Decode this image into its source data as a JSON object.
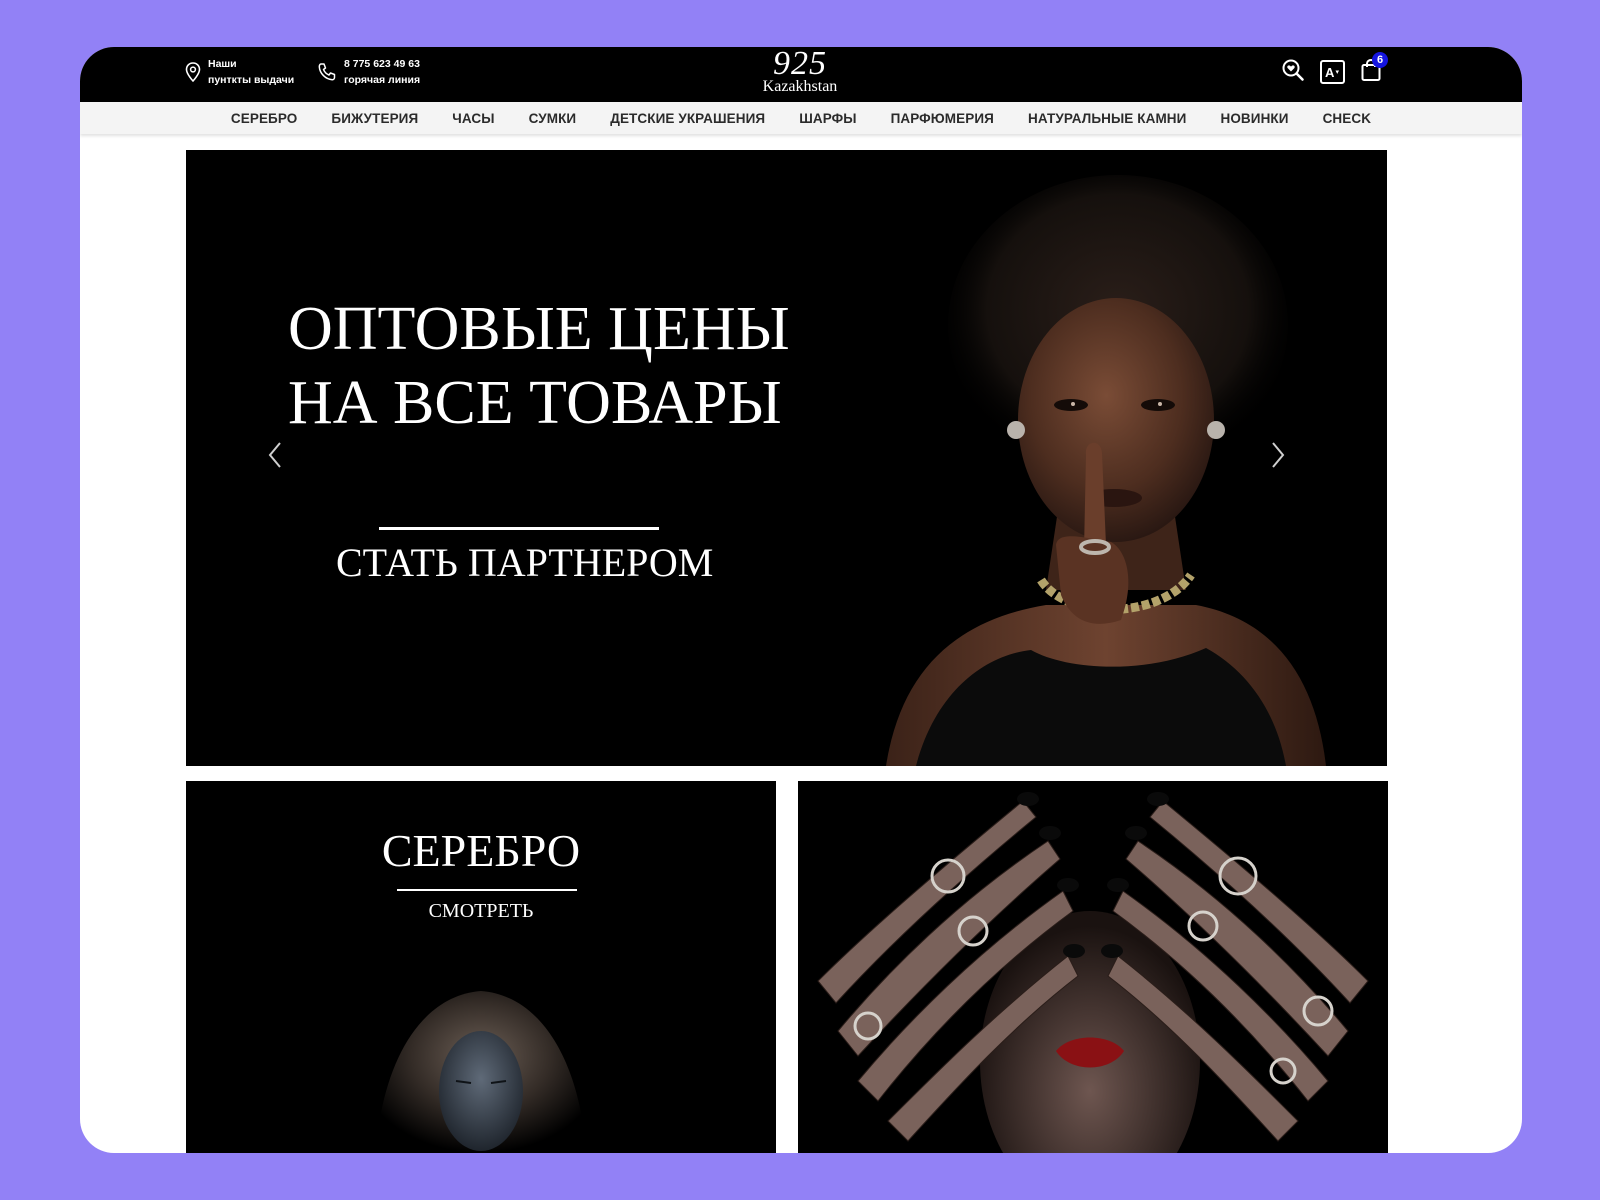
{
  "header": {
    "pickup": {
      "line1": "Наши",
      "line2": "пунткты выдачи",
      "icon": "location-pin-icon"
    },
    "hotline": {
      "number": "8 775 623 49 63",
      "label": "горячая линия",
      "icon": "phone-icon"
    },
    "logo": {
      "number": "925",
      "subtitle": "Kazakhstan"
    },
    "actions": {
      "search_icon": "search-heart-icon",
      "language_label": "A",
      "cart_icon": "shopping-bag-icon",
      "cart_count": "6"
    }
  },
  "nav": {
    "items": [
      "СЕРЕБРО",
      "БИЖУТЕРИЯ",
      "ЧАСЫ",
      "СУМКИ",
      "ДЕТСКИЕ УКРАШЕНИЯ",
      "ШАРФЫ",
      "ПАРФЮМЕРИЯ",
      "НАТУРАЛЬНЫЕ КАМНИ",
      "НОВИНКИ",
      "CHECK"
    ]
  },
  "hero": {
    "line1": "ОПТОВЫЕ ЦЕНЫ",
    "line2": "НА ВСЕ ТОВАРЫ",
    "cta": "СТАТЬ ПАРТНЕРОМ",
    "prev_icon": "chevron-left-icon",
    "next_icon": "chevron-right-icon"
  },
  "tiles": {
    "silver": {
      "title": "СЕРЕБРО",
      "link": "СМОТРЕТЬ"
    }
  },
  "colors": {
    "page_background": "#9281f6",
    "header_background": "#000000",
    "nav_background": "#f4f4f4",
    "badge": "#1515e0"
  }
}
